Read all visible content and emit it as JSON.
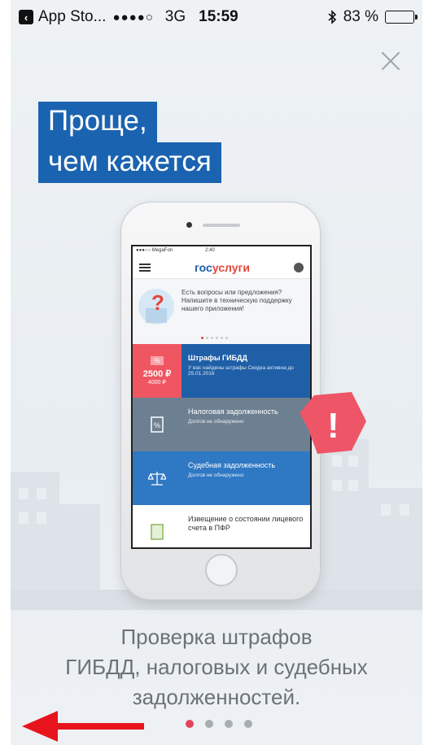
{
  "status_bar": {
    "back_app": "App Sto...",
    "signal": "●●●●○",
    "network": "3G",
    "time": "15:59",
    "bluetooth_icon": "bluetooth-icon",
    "battery": "83 %",
    "battery_level": 0.83
  },
  "close_icon": "close-icon",
  "headline": {
    "line1": "Проще,",
    "line2": "чем кажется"
  },
  "phone": {
    "mini_status": {
      "carrier": "●●●○○ MegaFon",
      "time": "2:40"
    },
    "logo": {
      "part1": "гос",
      "part2": "услуги"
    },
    "banner_text": "Есть вопросы или предложения? Напишите в техническую поддержку нашего приложения!",
    "rows": [
      {
        "title": "Штрафы ГИБДД",
        "subtitle": "У вас найдены штрафы Скидка активна до 25.01.2016",
        "price": "2500 ₽",
        "old_price": "4000 ₽",
        "badge": "%"
      },
      {
        "title": "Налоговая задолженность",
        "subtitle": "Долгов не обнаружено",
        "icon": "tax-document-icon"
      },
      {
        "title": "Судебная задолженность",
        "subtitle": "Долгов не обнаружено",
        "icon": "scales-icon"
      },
      {
        "title": "Извещение о состоянии лицевого счета в ПФР",
        "icon": "document-icon"
      }
    ]
  },
  "alert_symbol": "!",
  "caption": {
    "line1": "Проверка штрафов",
    "line2": "ГИБДД, налоговых и судебных",
    "line3": "задолженностей."
  },
  "pager": {
    "count": 4,
    "active": 0
  },
  "colors": {
    "brand_blue": "#1a63b0",
    "accent_red": "#e2455a",
    "arrow_red": "#e8141d"
  }
}
